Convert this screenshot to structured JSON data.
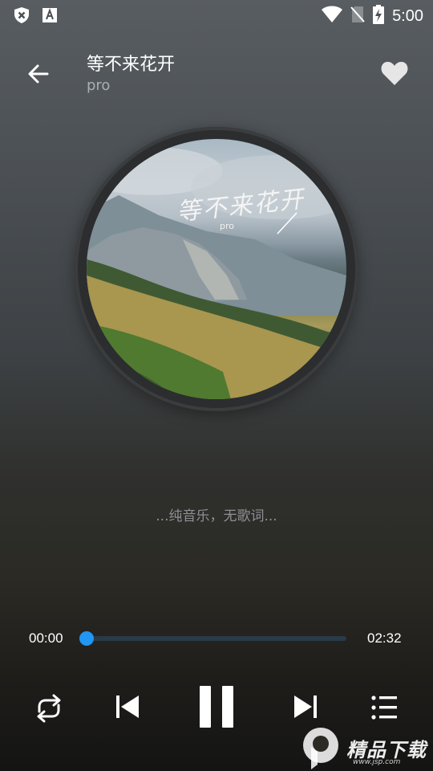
{
  "status_bar": {
    "time": "5:00",
    "left_icons": [
      "shield-x-icon",
      "font-a-icon"
    ],
    "right_icons": [
      "wifi-icon",
      "no-sim-icon",
      "battery-charging-icon"
    ]
  },
  "header": {
    "title": "等不来花开",
    "artist": "pro",
    "favorite": true
  },
  "album_art": {
    "calligraphy": "等不来花开",
    "tag": "pro"
  },
  "lyrics": {
    "text": "...纯音乐，无歌词..."
  },
  "player": {
    "current_time": "00:00",
    "total_time": "02:32",
    "progress": 0.0,
    "state": "playing",
    "accent_color": "#2196f3"
  },
  "controls": [
    "repeat-icon",
    "previous-icon",
    "pause-icon",
    "next-icon",
    "playlist-icon"
  ],
  "watermark": {
    "brand": "精品下载",
    "site": "www.jsp.com"
  }
}
